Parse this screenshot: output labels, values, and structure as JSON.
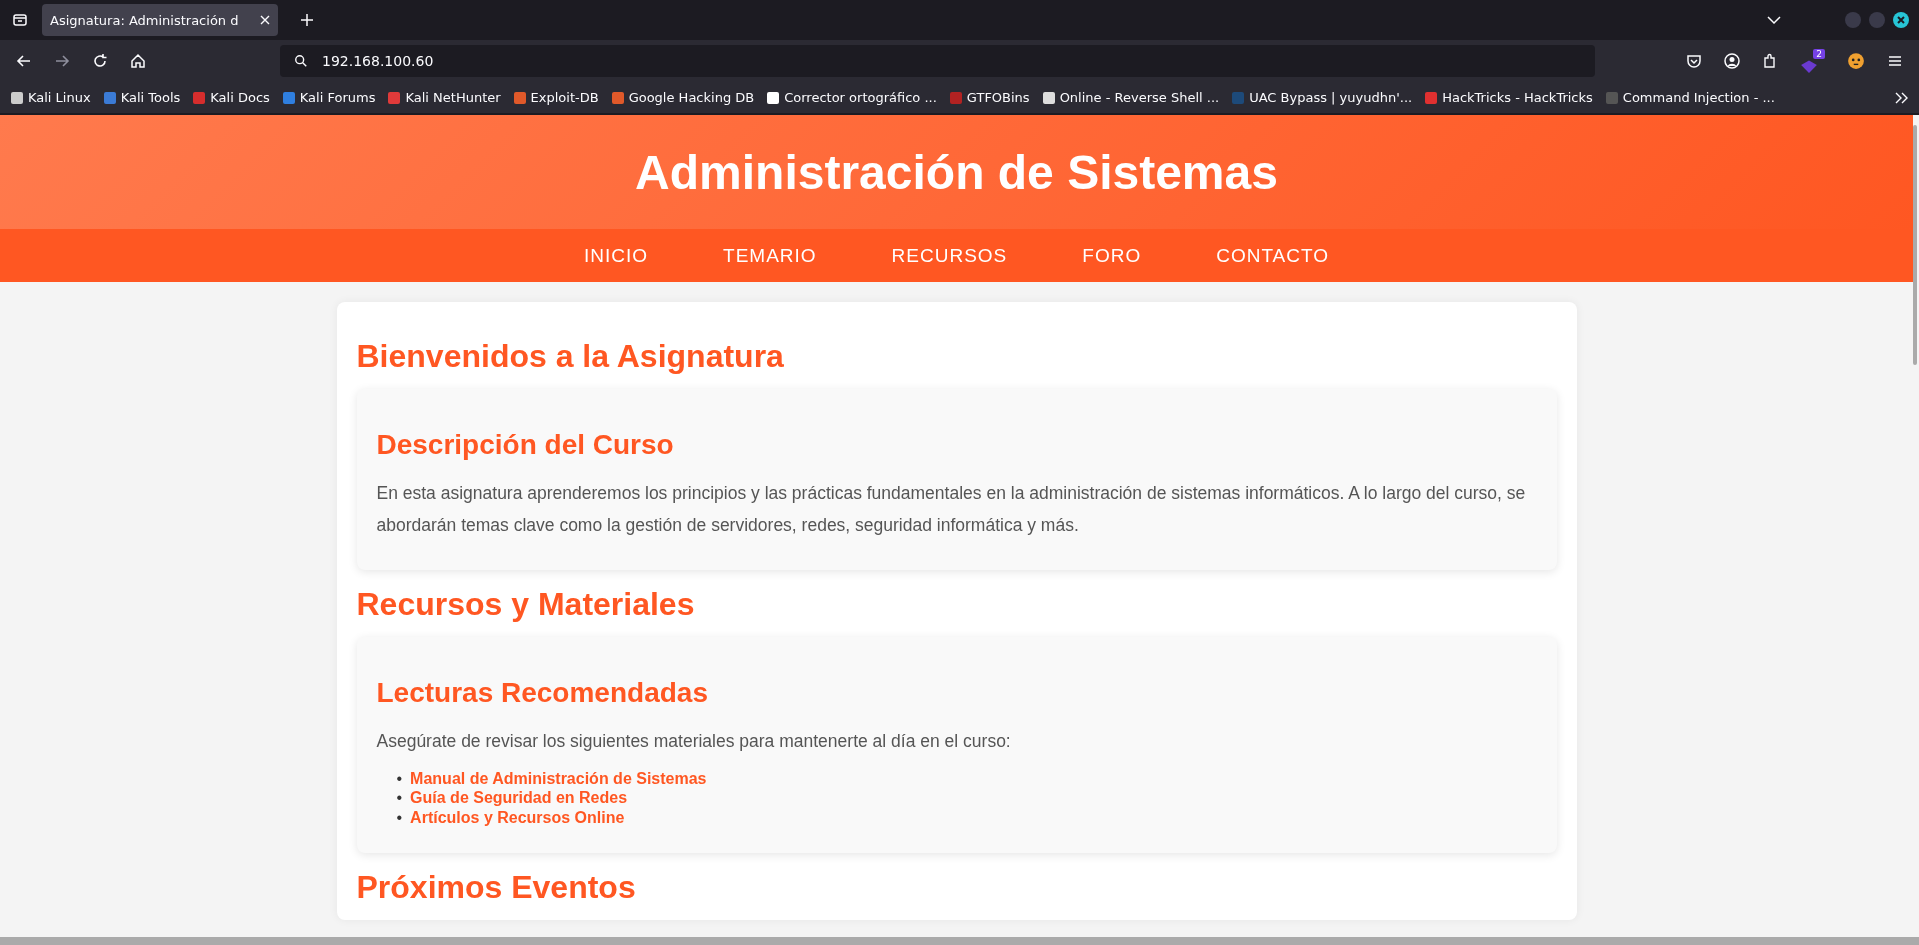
{
  "browser": {
    "tabs": [
      {
        "title": "Asignatura: Administración d",
        "selected": true
      }
    ],
    "address": "192.168.100.60",
    "extension_badge": "2",
    "bookmarks": [
      {
        "label": "Kali Linux",
        "color": "#cccccc"
      },
      {
        "label": "Kali Tools",
        "color": "#3b7bd6"
      },
      {
        "label": "Kali Docs",
        "color": "#d62d2d"
      },
      {
        "label": "Kali Forums",
        "color": "#2f7fe0"
      },
      {
        "label": "Kali NetHunter",
        "color": "#e03a3a"
      },
      {
        "label": "Exploit-DB",
        "color": "#e0592a"
      },
      {
        "label": "Google Hacking DB",
        "color": "#e0592a"
      },
      {
        "label": "Corrector ortográfico ...",
        "color": "#ffffff"
      },
      {
        "label": "GTFOBins",
        "color": "#b22222"
      },
      {
        "label": "Online - Reverse Shell ...",
        "color": "#dddddd"
      },
      {
        "label": "UAC Bypass | yuyudhn'...",
        "color": "#1d4a7a"
      },
      {
        "label": "HackTricks - HackTricks",
        "color": "#e03030"
      },
      {
        "label": "Command Injection - ...",
        "color": "#555555"
      }
    ]
  },
  "site": {
    "title": "Administración de Sistemas",
    "nav": [
      "INICIO",
      "TEMARIO",
      "RECURSOS",
      "FORO",
      "CONTACTO"
    ],
    "sections": [
      {
        "heading": "Bienvenidos a la Asignatura",
        "cards": [
          {
            "heading": "Descripción del Curso",
            "text": "En esta asignatura aprenderemos los principios y las prácticas fundamentales en la administración de sistemas informáticos. A lo largo del curso, se abordarán temas clave como la gestión de servidores, redes, seguridad informática y más."
          }
        ]
      },
      {
        "heading": "Recursos y Materiales",
        "cards": [
          {
            "heading": "Lecturas Recomendadas",
            "text": "Asegúrate de revisar los siguientes materiales para mantenerte al día en el curso:",
            "bullet": "•",
            "links": [
              "Manual de Administración de Sistemas",
              "Guía de Seguridad en Redes",
              "Artículos y Recursos Online"
            ]
          }
        ]
      },
      {
        "heading": "Próximos Eventos"
      }
    ]
  }
}
